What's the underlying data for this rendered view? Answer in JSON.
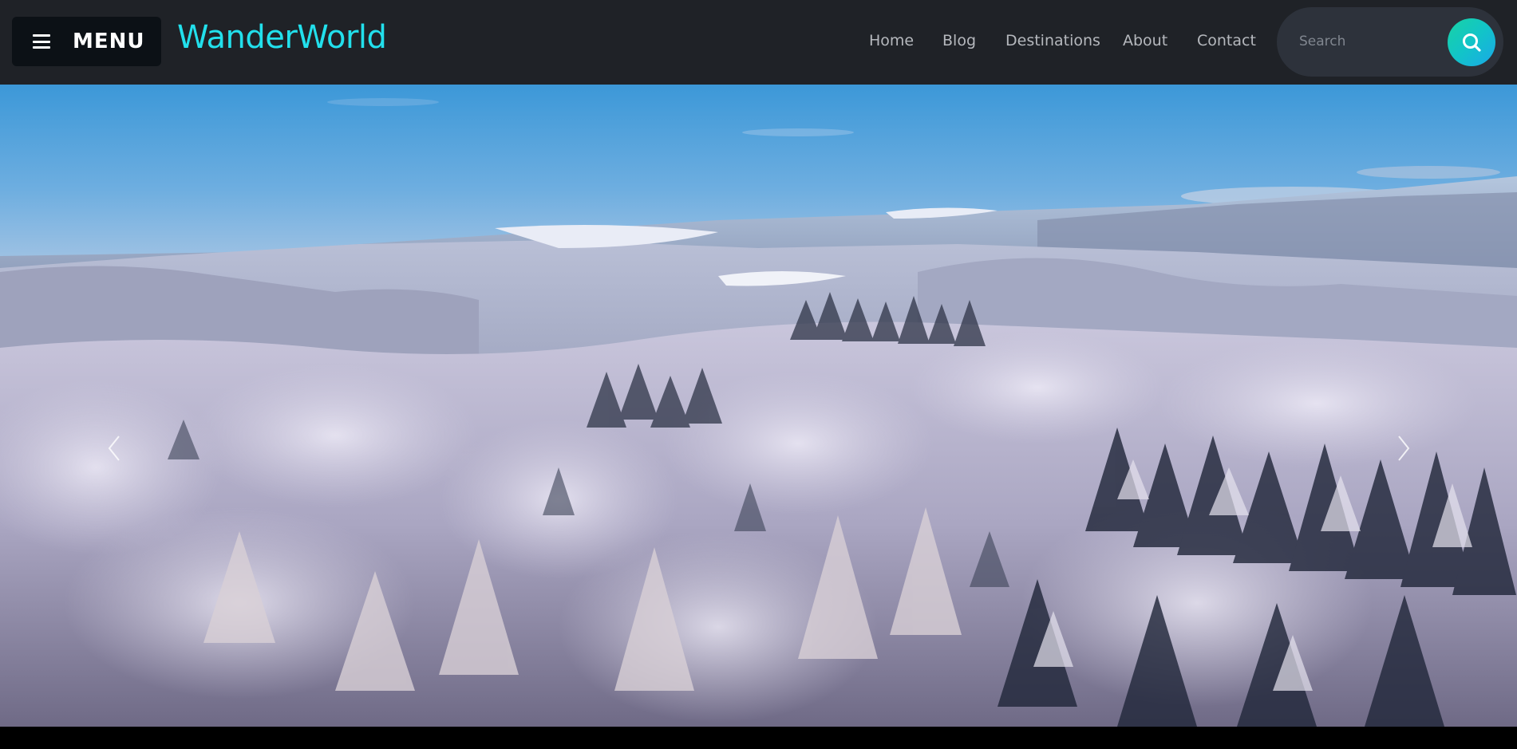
{
  "header": {
    "menu_label": "MENU",
    "logo_text": "WanderWorld",
    "nav": {
      "home": "Home",
      "blog": "Blog",
      "destinations": "Destinations",
      "about": "About",
      "contact": "Contact"
    },
    "search": {
      "placeholder": "Search",
      "icon": "search-icon"
    }
  },
  "hero": {
    "image": "snow-covered forest landscape under blue sky",
    "prev_icon": "chevron-left-icon",
    "next_icon": "chevron-right-icon"
  },
  "colors": {
    "header_bg": "#1f2227",
    "menu_bg": "#0c1116",
    "logo": "#22e0ec",
    "nav_text": "#b5b8bd",
    "search_bg": "#2d323b",
    "search_button": "#14c6c0"
  }
}
